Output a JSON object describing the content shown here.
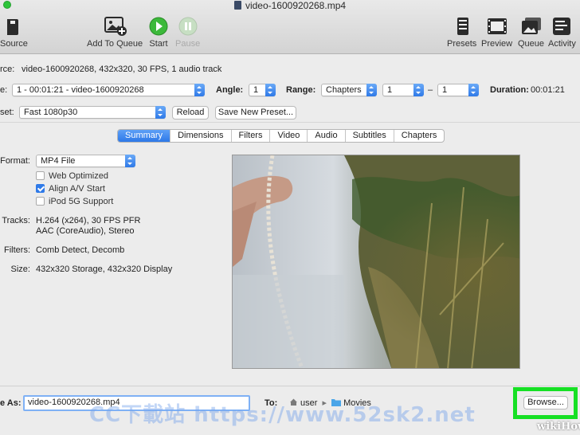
{
  "window": {
    "title": "video-1600920268.mp4"
  },
  "toolbar": {
    "source": "Source",
    "add_to_queue": "Add To Queue",
    "start": "Start",
    "pause": "Pause",
    "presets": "Presets",
    "preview": "Preview",
    "queue": "Queue",
    "activity": "Activity"
  },
  "source_info": {
    "label": "rce:",
    "text": "video-1600920268, 432x320, 30 FPS, 1 audio track"
  },
  "title_row": {
    "label": "e:",
    "title_value": "1 - 00:01:21 - video-1600920268",
    "angle_label": "Angle:",
    "angle_value": "1",
    "range_label": "Range:",
    "range_type": "Chapters",
    "range_start": "1",
    "range_dash": "–",
    "range_end": "1",
    "duration_label": "Duration:",
    "duration_value": "00:01:21"
  },
  "preset_row": {
    "label": "set:",
    "preset_value": "Fast 1080p30",
    "reload": "Reload",
    "save_new": "Save New Preset..."
  },
  "tabs": [
    "Summary",
    "Dimensions",
    "Filters",
    "Video",
    "Audio",
    "Subtitles",
    "Chapters"
  ],
  "summary": {
    "format_label": "Format:",
    "format_value": "MP4 File",
    "web_optimized": "Web Optimized",
    "align_av": "Align A/V Start",
    "ipod": "iPod 5G Support",
    "tracks_label": "Tracks:",
    "tracks_line1": "H.264 (x264), 30 FPS PFR",
    "tracks_line2": "AAC (CoreAudio), Stereo",
    "filters_label": "Filters:",
    "filters_value": "Comb Detect, Decomb",
    "size_label": "Size:",
    "size_value": "432x320 Storage, 432x320 Display"
  },
  "save": {
    "label": "e As:",
    "filename": "video-1600920268.mp4",
    "to_label": "To:",
    "path_user": "user",
    "path_sep": "▸",
    "path_folder": "Movies",
    "browse": "Browse..."
  },
  "watermark": "CC下載站 https://www.52sk2.net",
  "brand": "wikiHow"
}
